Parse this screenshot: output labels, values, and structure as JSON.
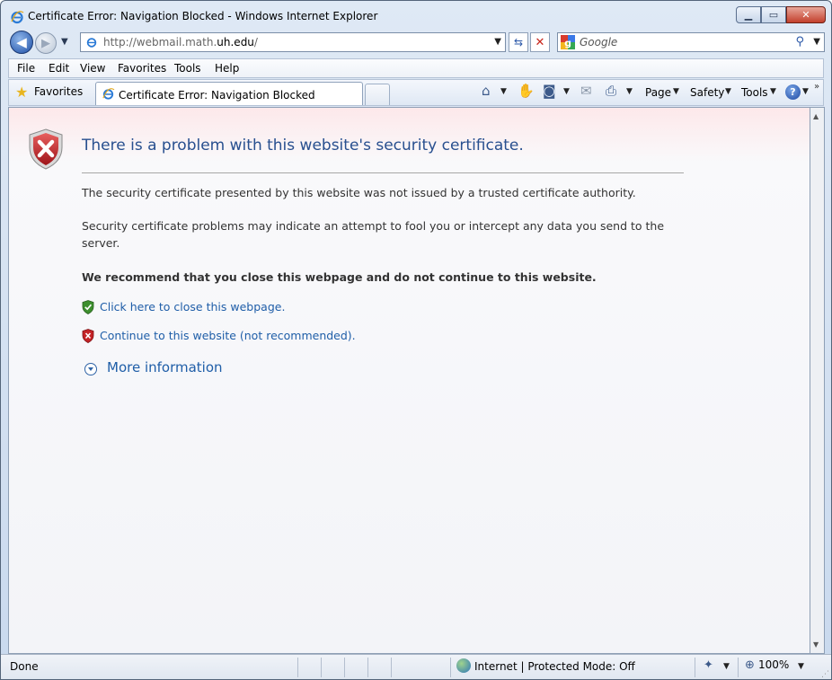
{
  "window": {
    "title": "Certificate Error: Navigation Blocked - Windows Internet Explorer",
    "minimize_glyph": "▁",
    "maximize_glyph": "▭",
    "close_glyph": "✕"
  },
  "navigation": {
    "back_glyph": "◀",
    "forward_glyph": "▶",
    "dropdown_glyph": "▼",
    "url_prefix": "http://webmail.math.",
    "url_domain": "uh.edu",
    "url_suffix": "/",
    "refresh_glyph": "⇆",
    "stop_glyph": "✕",
    "search_placeholder": "Google",
    "search_glyph": "⚲"
  },
  "menu": {
    "items": [
      "File",
      "Edit",
      "View",
      "Favorites",
      "Tools",
      "Help"
    ]
  },
  "favorites_bar": {
    "favorites_label": "Favorites",
    "star_glyph": "★",
    "tab_title": "Certificate Error: Navigation Blocked",
    "home_glyph": "⌂",
    "hand_glyph": "✋",
    "feed_glyph": "◙",
    "mail_glyph": "✉",
    "print_glyph": "⎙",
    "page_label": "Page",
    "safety_label": "Safety",
    "tools_label": "Tools",
    "help_glyph": "?",
    "more_glyph": "»"
  },
  "content": {
    "heading": "There is a problem with this website's security certificate.",
    "paragraph_1": "The security certificate presented by this website was not issued by a trusted certificate authority.",
    "paragraph_2": "Security certificate problems may indicate an attempt to fool you or intercept any data you send to the server.",
    "recommendation": "We recommend that you close this webpage and do not continue to this website.",
    "close_link": "Click here to close this webpage.",
    "continue_link": "Continue to this website (not recommended).",
    "more_info": "More information"
  },
  "status_bar": {
    "status": "Done",
    "zone": "Internet | Protected Mode: Off",
    "zoom": "100%",
    "zoom_glyph": "⊕",
    "addons_glyph": "✦"
  },
  "colors": {
    "heading": "#284f8f",
    "link": "#1f5ea8",
    "error_shield": "#c42327",
    "safe_shield": "#3d8f2e"
  }
}
